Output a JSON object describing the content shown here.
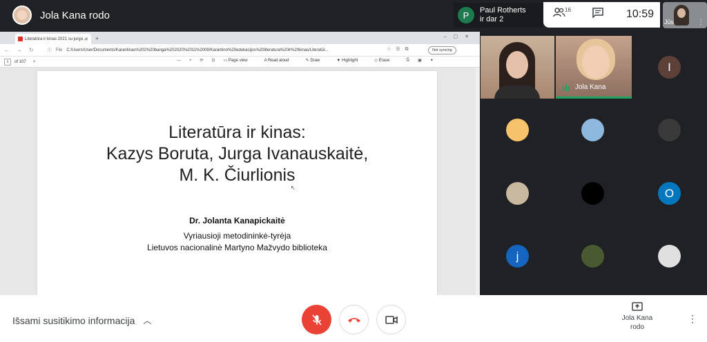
{
  "header": {
    "presenter_name": "Jola Kana rodo",
    "pinned_name": "Paul Rotherts",
    "pinned_sub": "ir dar 2",
    "pinned_initial": "P",
    "people_count": "16",
    "time": "10:59",
    "self_label": "Jūs"
  },
  "browser": {
    "tab_title": "Literatūra ir kinas 2021 su jurgo...",
    "new_tab": "+",
    "file_label": "File",
    "address": "C:/Users/User/Documents/Karantinas%202%20banga%202020%2011%2009/Karantino%20edukacijos%20literatura%20ir%20kinas/Literatūr...",
    "sync_label": "Not syncing",
    "page_current": "1",
    "page_total": "of 107",
    "tools": [
      "Page view",
      "Read aloud",
      "Draw",
      "Highlight",
      "Erase"
    ]
  },
  "slide": {
    "title_line1": "Literatūra ir kinas:",
    "title_line2": "Kazys Boruta, Jurga Ivanauskaitė,",
    "title_line3": "M. K. Čiurlionis",
    "author": "Dr.  Jolanta Kanapickaitė",
    "role": "Vyriausioji metodininkė-tyrėja",
    "institution": "Lietuvos nacionalinė Martyno Mažvydo biblioteka"
  },
  "participants": {
    "speaker_label": "Jola Kana",
    "circles": [
      {
        "initial": "I",
        "color": "#5d4037"
      },
      {
        "initial": "",
        "color": "#f6c26b"
      },
      {
        "initial": "",
        "color": "#8fb8de"
      },
      {
        "initial": "",
        "color": "#3a3a3a"
      },
      {
        "initial": "",
        "color": "#c9b8a0"
      },
      {
        "initial": "",
        "color": "#000000"
      },
      {
        "initial": "O",
        "color": "#0277bd"
      },
      {
        "initial": "j",
        "color": "#1565c0"
      },
      {
        "initial": "",
        "color": "#4a5a30"
      },
      {
        "initial": "",
        "color": "#e0e0e0"
      }
    ]
  },
  "footer": {
    "meeting_info": "Išsami susitikimo informacija",
    "present_line1": "Jola Kana",
    "present_line2": "rodo"
  }
}
